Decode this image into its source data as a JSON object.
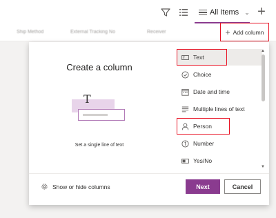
{
  "toolbar": {
    "filter_icon": "filter-icon",
    "view_icon": "view-list-icon",
    "view_name": "All Items",
    "add_icon": "plus-icon"
  },
  "columns": {
    "headers": [
      "Ship Method",
      "External Tracking No",
      "Receiver"
    ],
    "add_column_label": "Add column"
  },
  "panel": {
    "title": "Create a column",
    "illustration_glyph": "T",
    "description": "Set a single line of text",
    "types": [
      {
        "label": "Text",
        "icon": "text-icon",
        "selected": true,
        "highlighted": true
      },
      {
        "label": "Choice",
        "icon": "choice-icon",
        "selected": false,
        "highlighted": false
      },
      {
        "label": "Date and time",
        "icon": "calendar-icon",
        "selected": false,
        "highlighted": false
      },
      {
        "label": "Multiple lines of text",
        "icon": "multiline-text-icon",
        "selected": false,
        "highlighted": false
      },
      {
        "label": "Person",
        "icon": "person-icon",
        "selected": false,
        "highlighted": true
      },
      {
        "label": "Number",
        "icon": "number-icon",
        "selected": false,
        "highlighted": false
      },
      {
        "label": "Yes/No",
        "icon": "yes-no-icon",
        "selected": false,
        "highlighted": false
      }
    ],
    "show_hide_label": "Show or hide columns",
    "next_label": "Next",
    "cancel_label": "Cancel"
  },
  "colors": {
    "accent": "#8a3b8f",
    "highlight": "#e81123",
    "selected_bg": "#edebe9"
  }
}
